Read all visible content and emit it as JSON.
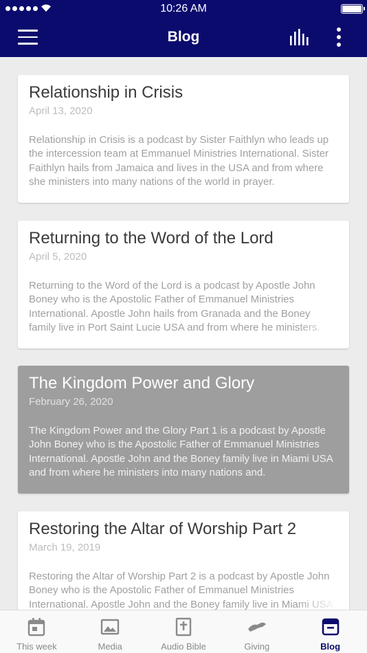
{
  "status_bar": {
    "time": "10:26 AM"
  },
  "nav": {
    "title": "Blog"
  },
  "posts": [
    {
      "title": "Relationship in Crisis",
      "date": "April 13, 2020",
      "excerpt": "Relationship in Crisis is a podcast by Sister Faithlyn who leads up the intercession team at Emmanuel Ministries International. Sister Faithlyn hails from Jamaica and lives in the USA and from where she ministers into many nations of the world in prayer."
    },
    {
      "title": "Returning to the Word of the Lord",
      "date": "April 5, 2020",
      "excerpt": "Returning to the Word of the Lord is a podcast by Apostle John Boney who is the Apostolic Father of Emmanuel Ministries International. Apostle John hails from Granada and the Boney family live in Port Saint Lucie USA and from where he ministers."
    },
    {
      "title": "The Kingdom Power and Glory",
      "date": "February 26, 2020",
      "excerpt": "The Kingdom Power and the Glory Part 1 is a podcast by Apostle John Boney who is the Apostolic Father of Emmanuel Ministries International. Apostle John and the Boney family live in Miami USA and from where he ministers into many nations and."
    },
    {
      "title": "Restoring the Altar of Worship Part 2",
      "date": "March 19, 2019",
      "excerpt": "Restoring the Altar of Worship Part 2 is a podcast by Apostle John Boney who is the Apostolic Father of Emmanuel Ministries International. Apostle John and the Boney family live in Miami USA."
    }
  ],
  "tabs": [
    {
      "label": "This week",
      "icon": "calendar-icon"
    },
    {
      "label": "Media",
      "icon": "image-icon"
    },
    {
      "label": "Audio Bible",
      "icon": "bible-icon"
    },
    {
      "label": "Giving",
      "icon": "handshake-icon"
    },
    {
      "label": "Blog",
      "icon": "archive-icon"
    }
  ],
  "colors": {
    "primary": "#0b0b6e",
    "selected_card": "#9e9e9e",
    "background": "#ececec",
    "tab_inactive": "#8a8a8a"
  }
}
